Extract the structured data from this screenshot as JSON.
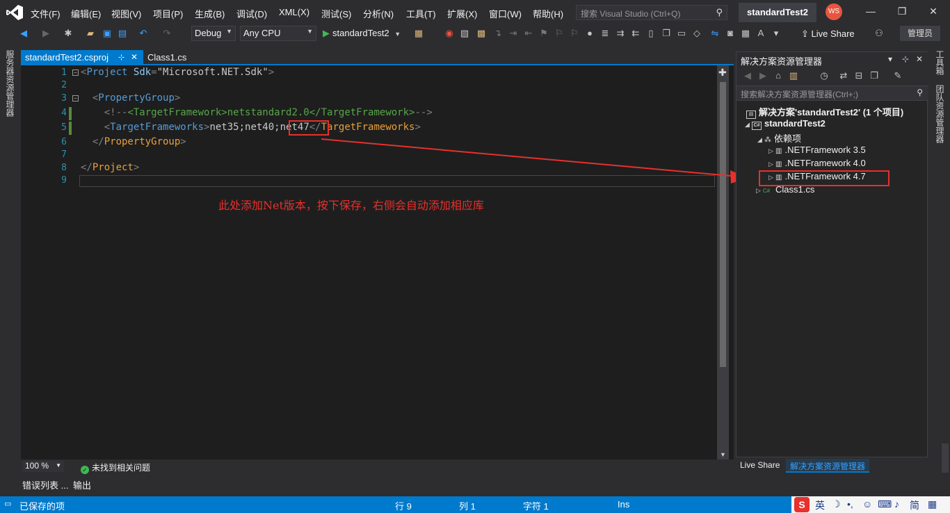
{
  "titlebar": {
    "menus": [
      "文件(F)",
      "编辑(E)",
      "视图(V)",
      "项目(P)",
      "生成(B)",
      "调试(D)",
      "XML(X)",
      "测试(S)",
      "分析(N)",
      "工具(T)",
      "扩展(X)",
      "窗口(W)",
      "帮助(H)"
    ],
    "search_placeholder": "搜索 Visual Studio (Ctrl+Q)",
    "solution_name": "standardTest2",
    "avatar_initials": "WS"
  },
  "toolbar": {
    "config": "Debug",
    "platform": "Any CPU",
    "run_target": "standardTest2",
    "live_share": "Live Share",
    "admin": "管理员"
  },
  "left_strip": {
    "label": "服务器资源管理器"
  },
  "right_strip": {
    "toolbox": "工具箱",
    "team_explorer": "团队资源管理器"
  },
  "editor": {
    "tabs": [
      {
        "label": "standardTest2.csproj",
        "pin": "⊹",
        "close": "✕"
      },
      {
        "label": "Class1.cs"
      }
    ],
    "line_numbers": [
      "1",
      "2",
      "3",
      "4",
      "5",
      "6",
      "7",
      "8",
      "9"
    ],
    "code": {
      "l1_open": "<",
      "l1_tag": "Project",
      "l1_attr": "Sdk",
      "l1_eq": "=",
      "l1_val": "\"Microsoft.NET.Sdk\"",
      "l1_close": ">",
      "l3_tag": "PropertyGroup",
      "l4_comment_open": "<!--",
      "l4_tag_open": "<TargetFramework>",
      "l4_value": "netstandard2.0",
      "l4_tag_close": "</TargetFramework>",
      "l4_comment_close": "-->",
      "l5_tag": "TargetFrameworks",
      "l5_value_a": "net35;net40",
      "l5_value_b": ";net47",
      "l5_close_tag": "TargetFrameworks",
      "l6_close_tag": "PropertyGroup",
      "l8_close_tag": "Project"
    },
    "annotation": "此处添加Net版本，按下保存，右侧会自动添加相应库",
    "zoom": "100 %",
    "issues": "未找到相关问题"
  },
  "bottom_tabs": [
    "错误列表 ...",
    "输出"
  ],
  "solution_explorer": {
    "title": "解决方案资源管理器",
    "search_placeholder": "搜索解决方案资源管理器(Ctrl+;)",
    "solution": "解决方案'standardTest2' (1 个项目)",
    "project": "standardTest2",
    "dependencies": "依赖项",
    "frameworks": [
      ".NETFramework 3.5",
      ".NETFramework 4.0",
      ".NETFramework 4.7"
    ],
    "file": "Class1.cs",
    "tabs": [
      "Live Share",
      "解决方案资源管理器"
    ]
  },
  "statusbar": {
    "saved": "已保存的项",
    "line": "行 9",
    "col": "列 1",
    "ch": "字符 1",
    "mode": "Ins",
    "ime_lang": "英",
    "ime_simp": "简"
  },
  "colors": {
    "accent": "#007acc",
    "annotation": "#e8302c",
    "editor_bg": "#1e1e1e"
  }
}
